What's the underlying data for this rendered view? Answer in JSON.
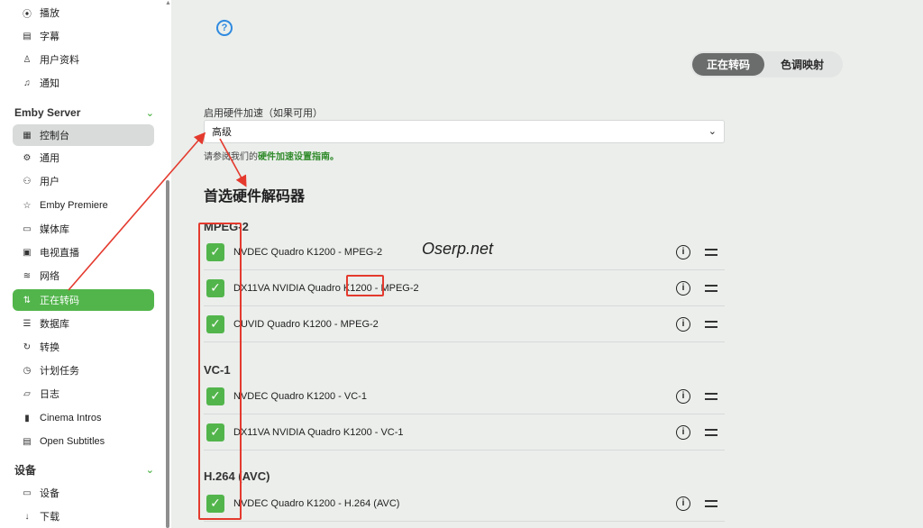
{
  "sidebar": {
    "top_items": [
      {
        "label": "播放",
        "icon": "play-circle-icon"
      },
      {
        "label": "字幕",
        "icon": "subtitles-icon"
      },
      {
        "label": "用户资料",
        "icon": "person-icon"
      },
      {
        "label": "通知",
        "icon": "bell-icon"
      }
    ],
    "server_section": {
      "title": "Emby Server",
      "items": [
        {
          "label": "控制台",
          "icon": "dashboard-icon"
        },
        {
          "label": "通用",
          "icon": "gear-icon"
        },
        {
          "label": "用户",
          "icon": "people-icon"
        },
        {
          "label": "Emby Premiere",
          "icon": "star-icon"
        },
        {
          "label": "媒体库",
          "icon": "folder-icon"
        },
        {
          "label": "电视直播",
          "icon": "live-tv-icon"
        },
        {
          "label": "网络",
          "icon": "wifi-icon"
        },
        {
          "label": "正在转码",
          "icon": "transcode-icon"
        },
        {
          "label": "数据库",
          "icon": "database-icon"
        },
        {
          "label": "转换",
          "icon": "convert-icon"
        },
        {
          "label": "计划任务",
          "icon": "clock-icon"
        },
        {
          "label": "日志",
          "icon": "folder-open-icon"
        },
        {
          "label": "Cinema Intros",
          "icon": "film-icon"
        },
        {
          "label": "Open Subtitles",
          "icon": "subtitles-icon"
        }
      ]
    },
    "devices_section": {
      "title": "设备",
      "items": [
        {
          "label": "设备",
          "icon": "devices-icon"
        },
        {
          "label": "下载",
          "icon": "download-icon"
        }
      ]
    }
  },
  "main": {
    "tabs": [
      {
        "label": "正在转码",
        "active": true
      },
      {
        "label": "色调映射",
        "active": false
      }
    ],
    "hw_accel": {
      "label": "启用硬件加速（如果可用）",
      "value": "高级",
      "help_prefix": "请参阅我们的",
      "help_link": "硬件加速设置指南。"
    },
    "decoder_title": "首选硬件解码器",
    "codecs": [
      {
        "name": "MPEG-2",
        "decoders": [
          "NVDEC Quadro K1200 - MPEG-2",
          "DX11VA NVIDIA Quadro K1200 - MPEG-2",
          "CUVID Quadro K1200 - MPEG-2"
        ]
      },
      {
        "name": "VC-1",
        "decoders": [
          "NVDEC Quadro K1200 - VC-1",
          "DX11VA NVIDIA Quadro K1200 - VC-1"
        ]
      },
      {
        "name": "H.264 (AVC)",
        "decoders": [
          "NVDEC Quadro K1200 - H.264 (AVC)"
        ]
      }
    ],
    "watermark": "Oserp.net"
  },
  "colors": {
    "accent": "#52b54b",
    "annotation": "#e43a2e",
    "help": "#2f8ae0"
  }
}
